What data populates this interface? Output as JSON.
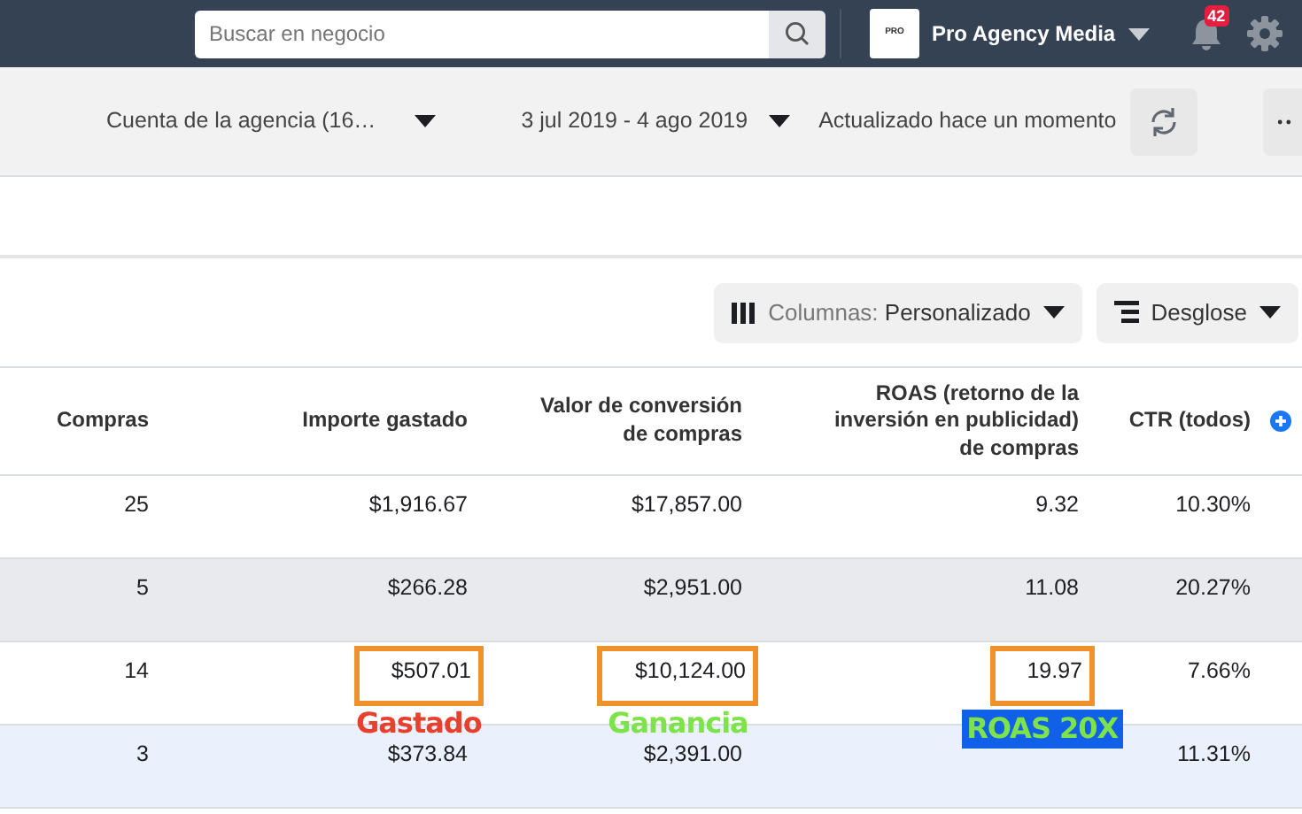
{
  "top_bar": {
    "search": {
      "placeholder": "Buscar en negocio"
    },
    "business": {
      "logo_text": "PRO",
      "name": "Pro Agency Media"
    },
    "notifications": {
      "count": "42"
    }
  },
  "report_bar": {
    "account": "Cuenta de la agencia (16…",
    "date_range": "3 jul 2019 - 4 ago 2019",
    "status": "Actualizado hace un momento"
  },
  "table_toolbar": {
    "columns_button": {
      "label": "Columnas:",
      "value": "Personalizado"
    },
    "breakdown_button": {
      "label": "Desglose"
    }
  },
  "table": {
    "columns": [
      "Compras",
      "Importe gastado",
      "Valor de conversión de compras",
      "ROAS (retorno de la inversión en publicidad) de compras",
      "CTR (todos)"
    ],
    "rows": [
      {
        "selected": false,
        "shaded": false,
        "cells": [
          {
            "text": "25"
          },
          {
            "text": "$1,916.67"
          },
          {
            "text": "$17,857.00"
          },
          {
            "text": "9.32"
          },
          {
            "text": "10.30%"
          }
        ]
      },
      {
        "selected": false,
        "shaded": true,
        "cells": [
          {
            "text": "5"
          },
          {
            "text": "$266.28"
          },
          {
            "text": "$2,951.00"
          },
          {
            "text": "11.08"
          },
          {
            "text": "20.27%"
          }
        ]
      },
      {
        "selected": false,
        "shaded": false,
        "cells": [
          {
            "text": "14"
          },
          {
            "text": "$507.01",
            "annotation": {
              "text": "Gastado",
              "color": "#e8402f",
              "kind": "plain"
            }
          },
          {
            "text": "$10,124.00",
            "annotation": {
              "text": "Ganancia",
              "color": "#7ee34a",
              "kind": "plain"
            }
          },
          {
            "text": "19.97",
            "annotation": {
              "text": "ROAS 20X",
              "color": "#7ee34a",
              "kind": "filled"
            }
          },
          {
            "text": "7.66%"
          }
        ]
      },
      {
        "selected": true,
        "shaded": false,
        "cells": [
          {
            "text": "3"
          },
          {
            "text": "$373.84"
          },
          {
            "text": "$2,391.00"
          },
          {},
          {
            "text": "11.31%"
          }
        ]
      }
    ]
  }
}
